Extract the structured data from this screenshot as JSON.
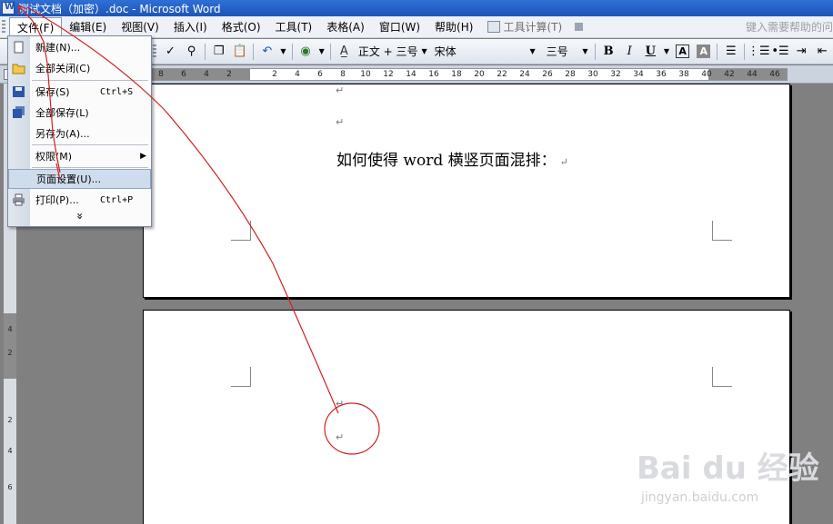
{
  "window": {
    "title": "测试文档（加密）.doc - Microsoft Word"
  },
  "menubar": {
    "items": [
      {
        "label": "文件(F)"
      },
      {
        "label": "编辑(E)"
      },
      {
        "label": "视图(V)"
      },
      {
        "label": "插入(I)"
      },
      {
        "label": "格式(O)"
      },
      {
        "label": "工具(T)"
      },
      {
        "label": "表格(A)"
      },
      {
        "label": "窗口(W)"
      },
      {
        "label": "帮助(H)"
      },
      {
        "label": "工具计算(T)"
      }
    ],
    "help_placeholder": "键入需要帮助的问"
  },
  "toolbar": {
    "style": "正文 + 三号",
    "font": "宋体",
    "size": "三号",
    "bold": "B",
    "italic": "I",
    "underline": "U",
    "border_char": "A",
    "shade_char": "A"
  },
  "ruler": {
    "ticks": [
      "8",
      "6",
      "4",
      "2",
      "2",
      "4",
      "6",
      "8",
      "10",
      "12",
      "14",
      "16",
      "18",
      "20",
      "22",
      "24",
      "26",
      "28",
      "30",
      "32",
      "34",
      "36",
      "38",
      "40",
      "42",
      "44",
      "46"
    ]
  },
  "vruler": {
    "ticks": [
      "4",
      "2",
      "2",
      "4",
      "6"
    ]
  },
  "file_menu": {
    "items": [
      {
        "label": "新建(N)...",
        "shortcut": "",
        "icon": "new-document-icon"
      },
      {
        "label": "全部关闭(C)",
        "shortcut": "",
        "icon": "folder-icon"
      },
      {
        "label": "保存(S)",
        "shortcut": "Ctrl+S",
        "icon": "save-disk-icon"
      },
      {
        "label": "全部保存(L)",
        "shortcut": "",
        "icon": "save-all-icon"
      },
      {
        "label": "另存为(A)...",
        "shortcut": "",
        "icon": ""
      },
      {
        "label": "权限(M)",
        "shortcut": "",
        "icon": ""
      },
      {
        "label": "页面设置(U)...",
        "shortcut": "",
        "icon": ""
      },
      {
        "label": "打印(P)...",
        "shortcut": "Ctrl+P",
        "icon": "printer-icon"
      }
    ],
    "more": "»"
  },
  "document": {
    "heading": "如何使得 word 横竖页面混排：",
    "para_mark": "↵"
  },
  "watermark": {
    "brand": "Bai du 经验",
    "url": "jingyan.baidu.com"
  },
  "colors": {
    "titlebar": "#1d55b8",
    "annotation": "#d42020",
    "highlight": "#cfdcec"
  }
}
